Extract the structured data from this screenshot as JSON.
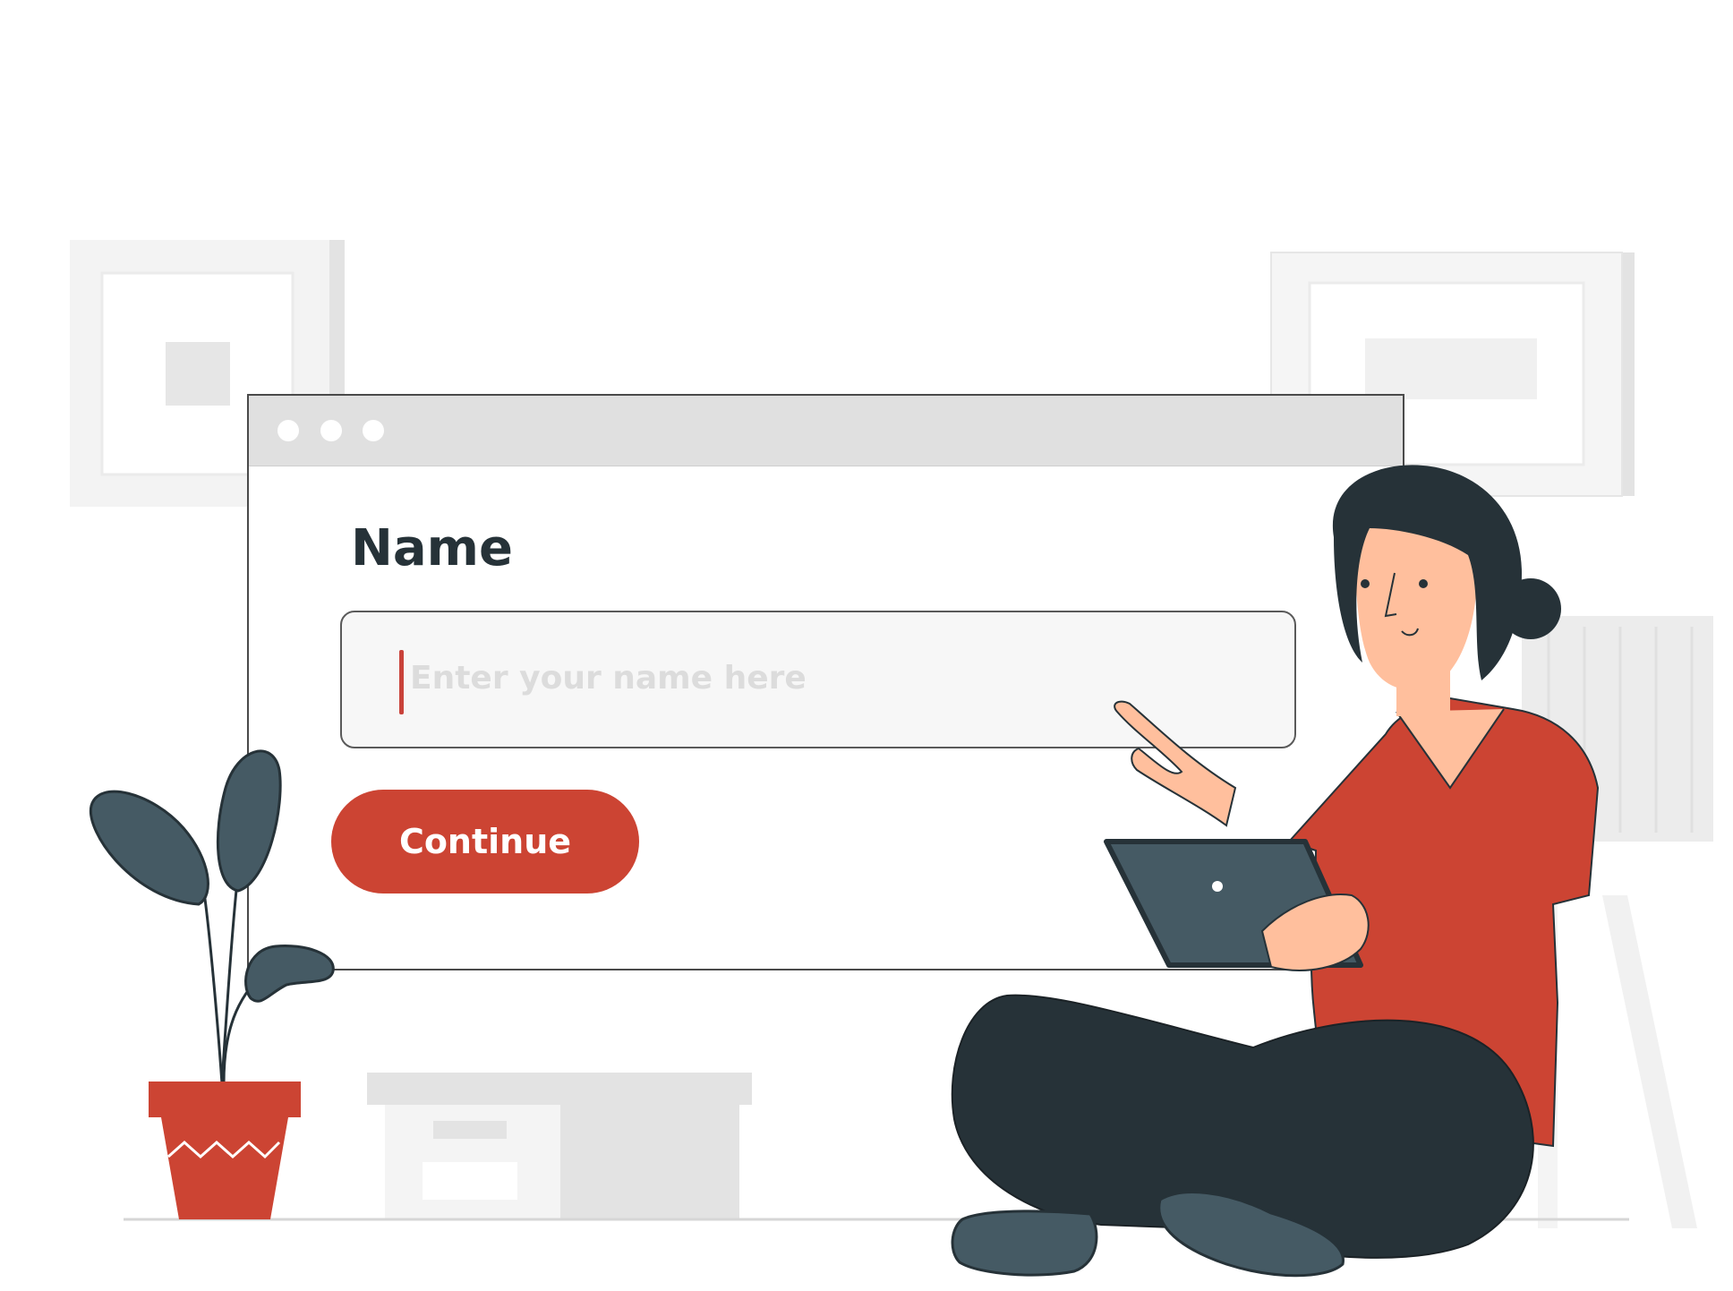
{
  "form": {
    "label": "Name",
    "input_placeholder": "Enter your name here",
    "input_value": "",
    "button_label": "Continue"
  },
  "colors": {
    "accent": "#cc4433",
    "text_dark": "#263238",
    "title_bar": "#e0e0e0",
    "input_bg": "#f7f7f7",
    "placeholder": "#dcdcdc",
    "slate": "#455a64"
  },
  "icons": {
    "window_controls": [
      "window-dot-icon",
      "window-dot-icon",
      "window-dot-icon"
    ],
    "tablet_camera": "tablet-camera-icon"
  }
}
